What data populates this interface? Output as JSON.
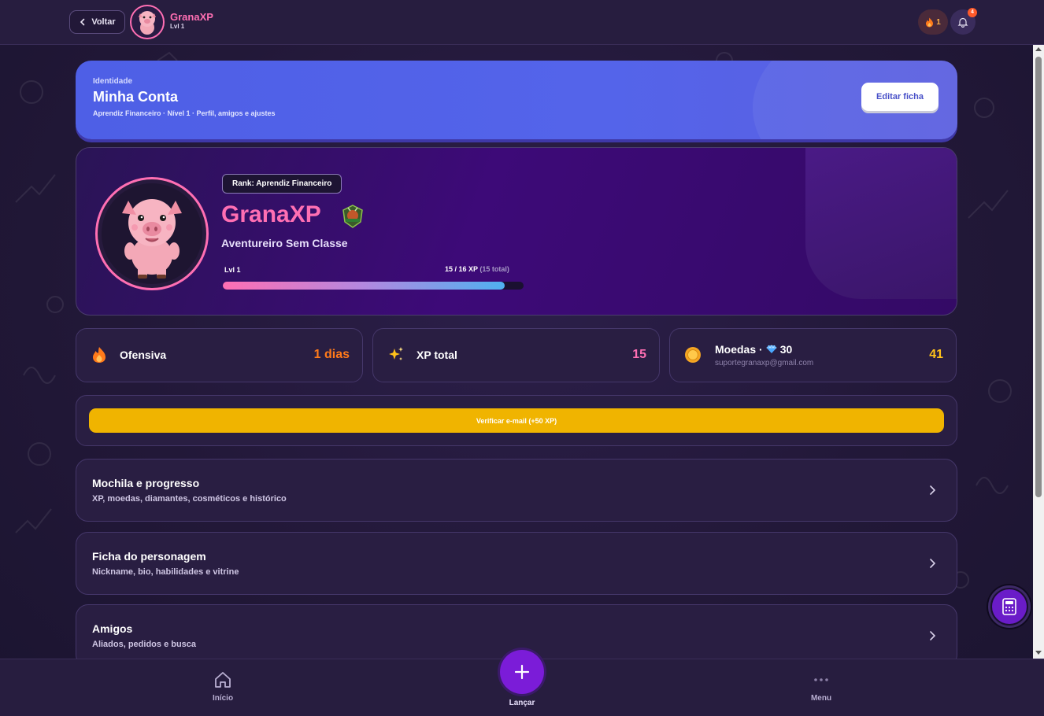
{
  "topbar": {
    "back_label": "Voltar",
    "brand_name": "GranaXP",
    "brand_level": "Lvl 1",
    "streak_count": "1",
    "notification_count": "4"
  },
  "header": {
    "kicker": "Identidade",
    "title": "Minha Conta",
    "subtitle": "Aprendiz Financeiro · Nível 1 · Perfil, amigos e ajustes",
    "edit_label": "Editar ficha"
  },
  "profile": {
    "rank": "Rank: Aprendiz Financeiro",
    "name": "GranaXP",
    "class": "Aventureiro Sem Classe",
    "level_label": "Lvl 1",
    "xp_current": "15 / 16 XP",
    "xp_total": "(15 total)",
    "xp_progress": 0.9375
  },
  "stats": {
    "streak": {
      "label": "Ofensiva",
      "value": "1 dias"
    },
    "xp": {
      "label": "XP total",
      "value": "15"
    },
    "coins": {
      "label": "Moedas ·",
      "diamonds": "30",
      "email": "suportegranaxp@gmail.com",
      "value": "41"
    }
  },
  "verify": {
    "label": "Verificar e-mail (+50 XP)"
  },
  "menu": [
    {
      "title": "Mochila e progresso",
      "subtitle": "XP, moedas, diamantes, cosméticos e histórico"
    },
    {
      "title": "Ficha do personagem",
      "subtitle": "Nickname, bio, habilidades e vitrine"
    },
    {
      "title": "Amigos",
      "subtitle": "Aliados, pedidos e busca"
    }
  ],
  "nav": {
    "home": "Início",
    "launch": "Lançar",
    "menu": "Menu"
  },
  "colors": {
    "brand_pink": "#ff6fb3",
    "accent_purple": "#7b1cd8",
    "header_blue": "#5464ea",
    "verify_yellow": "#f0b400",
    "streak_orange": "#ff7a1a",
    "coins_gold": "#ffc21a"
  }
}
